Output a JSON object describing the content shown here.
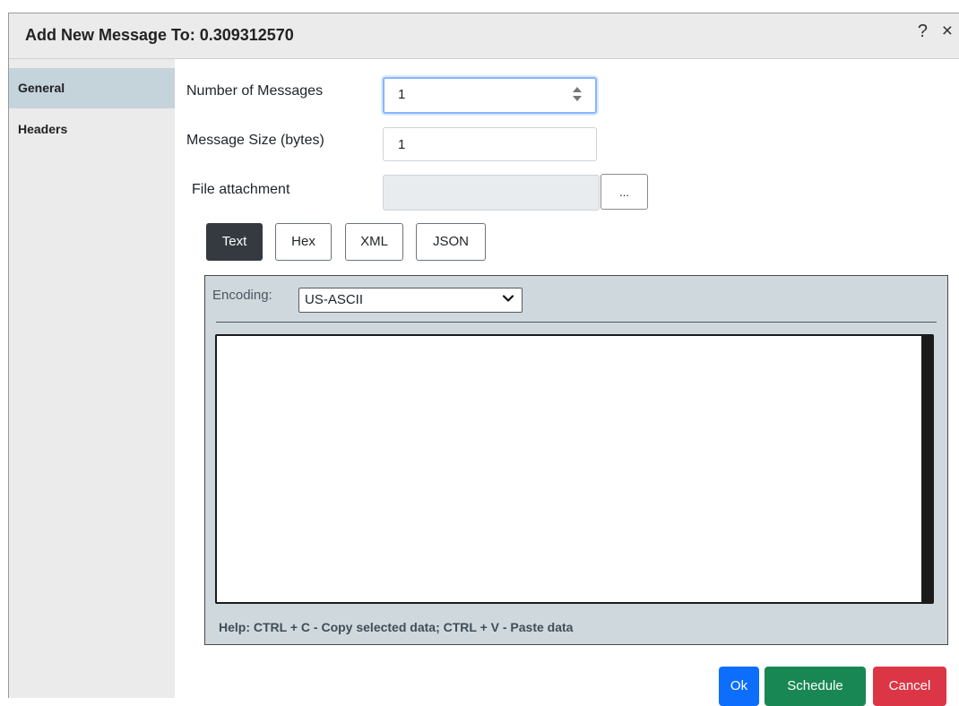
{
  "dialog": {
    "title": "Add New Message To: 0.309312570",
    "help_symbol": "?",
    "close_symbol": "×"
  },
  "sidebar": {
    "items": [
      {
        "label": "General",
        "active": true
      },
      {
        "label": "Headers",
        "active": false
      }
    ]
  },
  "form": {
    "number_of_messages_label": "Number of Messages",
    "number_of_messages_value": "1",
    "message_size_label": "Message Size (bytes)",
    "message_size_value": "1",
    "file_attachment_label": "File attachment",
    "file_attachment_value": "",
    "browse_label": "..."
  },
  "format_tabs": [
    {
      "label": "Text",
      "active": true
    },
    {
      "label": "Hex",
      "active": false
    },
    {
      "label": "XML",
      "active": false
    },
    {
      "label": "JSON",
      "active": false
    }
  ],
  "editor": {
    "encoding_label": "Encoding:",
    "encoding_value": "US-ASCII",
    "content": "",
    "help_text": "Help: CTRL + C - Copy selected data; CTRL + V - Paste data"
  },
  "actions": {
    "ok_label": "Ok",
    "schedule_label": "Schedule",
    "cancel_label": "Cancel"
  },
  "colors": {
    "ok": "#0d6efd",
    "schedule": "#198754",
    "cancel": "#dc3545",
    "active_nav": "#c5d3db",
    "active_tab": "#343a40"
  },
  "icons": {
    "spinner": "spinner-arrows-icon",
    "dropdown": "chevron-down-icon"
  }
}
